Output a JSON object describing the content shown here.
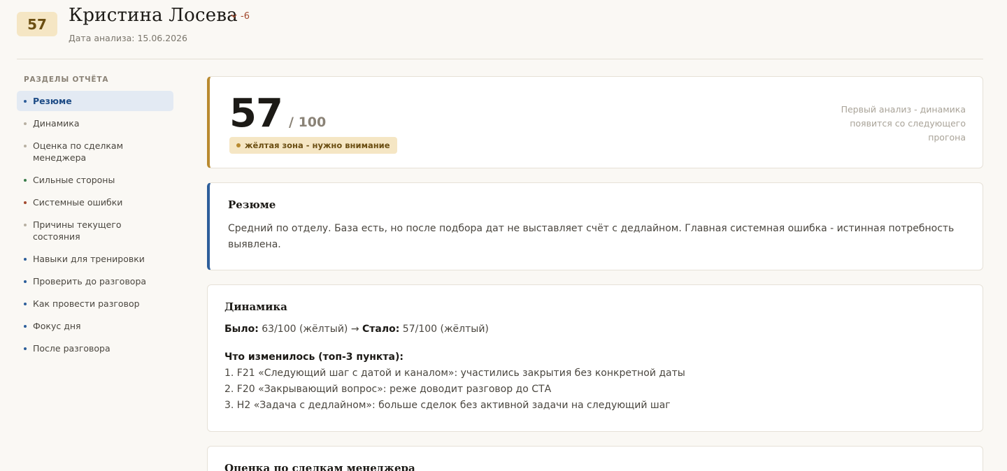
{
  "header": {
    "score": "57",
    "name": "Кристина  Лосева",
    "delta": "-6",
    "date": "Дата анализа: 15.06.2026"
  },
  "sidebar": {
    "title": "РАЗДЕЛЫ ОТЧЁТА",
    "items": [
      {
        "label": "Резюме",
        "active": true,
        "dot": "#2d5e9a"
      },
      {
        "label": "Динамика",
        "dot": "#b8b0a2"
      },
      {
        "label": "Оценка по сделкам менеджера",
        "dot": "#b8b0a2"
      },
      {
        "label": "Сильные стороны",
        "dot": "#3a7d4a"
      },
      {
        "label": "Системные ошибки",
        "dot": "#a34a2f"
      },
      {
        "label": "Причины текущего состояния",
        "dot": "#b8b0a2"
      },
      {
        "label": "Навыки для тренировки",
        "dot": "#2d5e9a"
      },
      {
        "label": "Проверить до разговора",
        "dot": "#2d5e9a"
      },
      {
        "label": "Как провести разговор",
        "dot": "#2d5e9a"
      },
      {
        "label": "Фокус дня",
        "dot": "#2d5e9a"
      },
      {
        "label": "После разговора",
        "dot": "#2d5e9a"
      }
    ]
  },
  "score_card": {
    "value": "57",
    "out_of": "/ 100",
    "zone": "жёлтая зона - нужно внимание",
    "note": "Первый анализ - динамика появится со следующего прогона"
  },
  "summary": {
    "title": "Резюме",
    "text": "Средний по отделу. База есть, но после подбора дат не выставляет счёт с дедлайном. Главная системная ошибка - истинная потребность выявлена."
  },
  "dynamics": {
    "title": "Динамика",
    "was_label": "Было:",
    "was_value": "63/100 (жёлтый) →",
    "now_label": "Стало:",
    "now_value": "57/100 (жёлтый)",
    "changes_title": "Что изменилось (топ-3 пункта):",
    "changes": [
      "1. F21 «Следующий шаг с датой и каналом»: участились закрытия без конкретной даты",
      "2. F20 «Закрывающий вопрос»: реже доводит разговор до СТА",
      "3. H2 «Задача с дедлайном»: больше сделок без активной задачи на следующий шаг"
    ]
  },
  "next_section": {
    "title": "Оценка по сделкам менеджера"
  },
  "colors": {
    "accent_gold": "#b98a2f",
    "accent_blue": "#2d5e9a",
    "zone_bg": "#f5e6c4"
  }
}
